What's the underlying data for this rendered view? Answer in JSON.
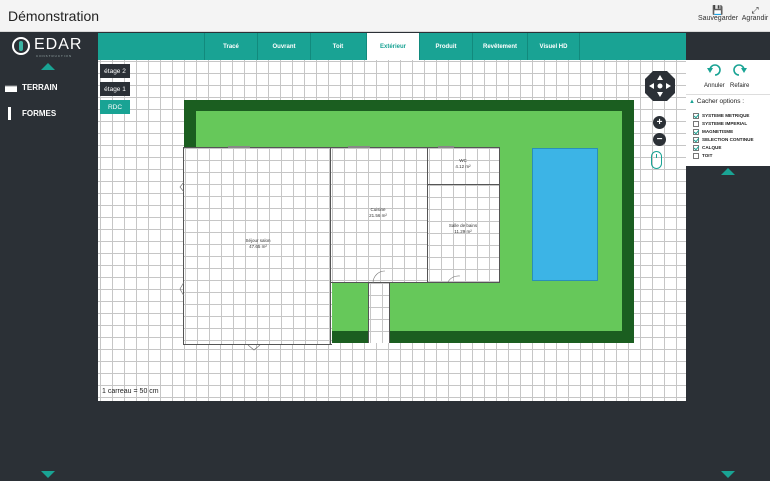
{
  "app": {
    "title": "Démonstration"
  },
  "toolbar": {
    "save_label": "Sauvegarder",
    "expand_label": "Agrandir"
  },
  "logo": {
    "name": "EDAR",
    "subtitle": "CONSTRUCTION"
  },
  "sidebar": {
    "items": [
      {
        "label": "TERRAIN",
        "icon": "terrain-icon"
      },
      {
        "label": "FORMES",
        "icon": "formes-icon"
      }
    ]
  },
  "tabs": [
    {
      "label": "Tracé",
      "active": false
    },
    {
      "label": "Ouvrant",
      "active": false
    },
    {
      "label": "Toit",
      "active": false
    },
    {
      "label": "Extérieur",
      "active": true
    },
    {
      "label": "Produit",
      "active": false
    },
    {
      "label": "Revêtement",
      "active": false
    },
    {
      "label": "Visuel HD",
      "active": false
    }
  ],
  "levels": [
    {
      "label": "étage 2",
      "active": false
    },
    {
      "label": "étage 1",
      "active": false
    },
    {
      "label": "RDC",
      "active": true
    }
  ],
  "rooms": [
    {
      "name": "Séjour salon",
      "area": "47.65 m²"
    },
    {
      "name": "Cuisine",
      "area": "21.56 m²"
    },
    {
      "name": "WC",
      "area": "4.12 m²"
    },
    {
      "name": "Salle de bains",
      "area": "11.29 m²"
    }
  ],
  "scale_label": "1 carreau = 50 cm",
  "history": {
    "undo_label": "Annuler",
    "redo_label": "Refaire"
  },
  "options": {
    "title": "Cacher options :",
    "items": [
      {
        "label": "SYSTEME METRIQUE",
        "checked": true
      },
      {
        "label": "SYSTEME IMPERIAL",
        "checked": false
      },
      {
        "label": "MAGNETISME",
        "checked": true
      },
      {
        "label": "SELECTION CONTINUE",
        "checked": true
      },
      {
        "label": "CALQUE",
        "checked": true
      },
      {
        "label": "TOIT",
        "checked": false
      }
    ]
  },
  "colors": {
    "accent": "#19a394",
    "dark": "#2b3036",
    "lawn": "#66c85a",
    "border_green": "#1b5e20",
    "pool": "#3cb4e6"
  }
}
